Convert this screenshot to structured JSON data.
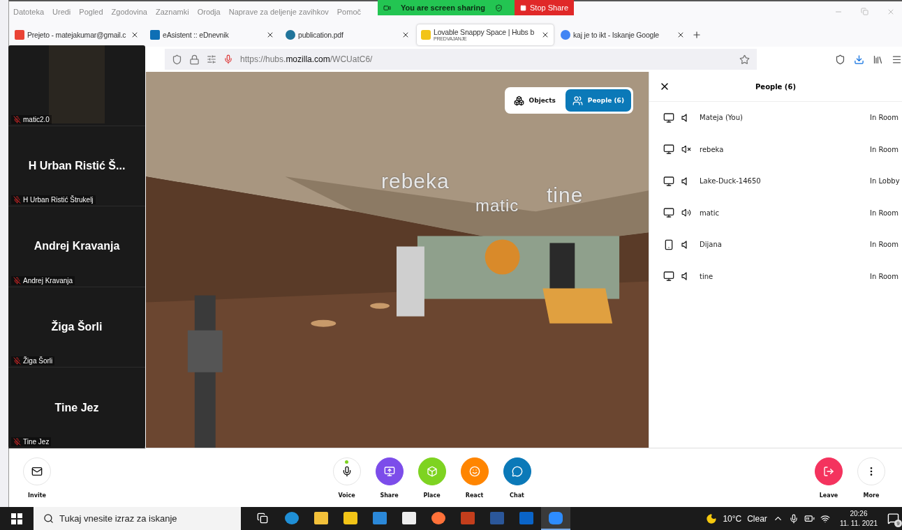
{
  "menu_bar": {
    "items": [
      "Datoteka",
      "Uredi",
      "Pogled",
      "Zgodovina",
      "Zaznamki",
      "Orodja",
      "Naprave za deljenje zavihkov",
      "Pomoč"
    ]
  },
  "sharing_banner": {
    "text": "You are screen sharing",
    "stop_label": "Stop Share"
  },
  "tabs": [
    {
      "title": "Prejeto - matejakumar@gmail.c",
      "selected": false
    },
    {
      "title": "eAsistent :: eDnevnik",
      "selected": false
    },
    {
      "title": "publication.pdf",
      "selected": false
    },
    {
      "title": "Lovable Snappy Space | Hubs b",
      "subtitle": "PREDVAJANJE",
      "selected": true
    },
    {
      "title": "kaj je to ikt - Iskanje Google",
      "selected": false
    }
  ],
  "address_bar": {
    "url": "https://hubs.**mozilla.com**/WCUatC6/"
  },
  "gallery": [
    {
      "kind": "video",
      "label": "matic2.0",
      "muted": true
    },
    {
      "kind": "name",
      "name": "H Urban Ristić Š...",
      "label": "H Urban Ristić Štrukelj",
      "muted": true
    },
    {
      "kind": "name",
      "name": "Andrej Kravanja",
      "label": "Andrej Kravanja",
      "muted": true
    },
    {
      "kind": "name",
      "name": "Žiga Šorli",
      "label": "Žiga Šorli",
      "muted": true
    },
    {
      "kind": "name",
      "name": "Tine Jez",
      "label": "Tine Jez",
      "muted": true
    }
  ],
  "scene": {
    "toggle": [
      {
        "label": "Objects",
        "selected": false
      },
      {
        "label": "People (6)",
        "selected": true
      }
    ],
    "name_tags": [
      "rebeka",
      "matic",
      "tine"
    ]
  },
  "people_panel": {
    "title": "People (6)",
    "people": [
      {
        "name": "Mateja (You)",
        "kind": "desktop",
        "muted": false,
        "speaking": false,
        "status": "In Room"
      },
      {
        "name": "rebeka",
        "kind": "desktop",
        "muted": true,
        "speaking": false,
        "status": "In Room"
      },
      {
        "name": "Lake-Duck-14650",
        "kind": "desktop",
        "muted": false,
        "speaking": false,
        "status": "In Lobby"
      },
      {
        "name": "matic",
        "kind": "desktop",
        "muted": false,
        "speaking": true,
        "status": "In Room"
      },
      {
        "name": "Dijana",
        "kind": "phone",
        "muted": false,
        "speaking": false,
        "status": "In Room"
      },
      {
        "name": "tine",
        "kind": "desktop",
        "muted": false,
        "speaking": false,
        "status": "In Room"
      }
    ]
  },
  "toolbar": {
    "left": [
      {
        "label": "Invite",
        "color": "#ffffff"
      }
    ],
    "center": [
      {
        "label": "Voice",
        "color": "#ffffff",
        "mic_on": true
      },
      {
        "label": "Share",
        "color": "#7c4dea"
      },
      {
        "label": "Place",
        "color": "#7ed321"
      },
      {
        "label": "React",
        "color": "#ff8500"
      },
      {
        "label": "Chat",
        "color": "#0b79b8"
      }
    ],
    "right": [
      {
        "label": "Leave",
        "color": "#f4335e"
      },
      {
        "label": "More",
        "color": "#ffffff"
      }
    ]
  },
  "taskbar": {
    "search_placeholder": "Tukaj vnesite izraz za iskanje",
    "apps": [
      {
        "selected": false
      },
      {
        "selected": false
      },
      {
        "selected": false
      },
      {
        "selected": false
      },
      {
        "selected": false
      },
      {
        "selected": false
      },
      {
        "selected": false
      },
      {
        "selected": false
      },
      {
        "selected": false
      },
      {
        "selected": false
      },
      {
        "selected": true
      }
    ],
    "temperature": "10°C",
    "weather": "Clear",
    "time": "20:26",
    "date": "11. 11. 2021",
    "notifications": "9"
  }
}
